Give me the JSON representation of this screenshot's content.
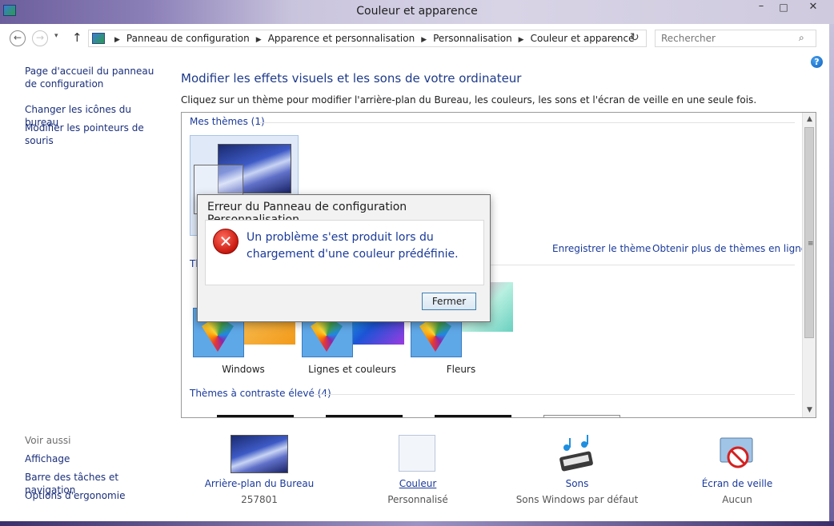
{
  "window": {
    "title": "Couleur et apparence",
    "controls": {
      "minimize": "–",
      "maximize": "□",
      "close": "✕"
    }
  },
  "nav": {
    "back": "←",
    "forward": "→",
    "recent": "▾",
    "up": "↑",
    "breadcrumbs": [
      "Panneau de configuration",
      "Apparence et personnalisation",
      "Personnalisation",
      "Couleur et apparence"
    ],
    "dropdown": "⌄",
    "refresh": "↻",
    "search_placeholder": "Rechercher",
    "search_icon": "⌕",
    "help": "?"
  },
  "sidebar": {
    "home_link": "Page d'accueil du panneau de configuration",
    "links": [
      "Changer les icônes du bureau",
      "Modifier les pointeurs de souris"
    ],
    "see_also_title": "Voir aussi",
    "see_also": [
      "Affichage",
      "Barre des tâches et navigation",
      "Options d'ergonomie"
    ]
  },
  "main": {
    "heading": "Modifier les effets visuels et les sons de votre ordinateur",
    "subtext": "Cliquez sur un thème pour modifier l'arrière-plan du Bureau, les couleurs, les sons et l'écran de veille en une seule fois.",
    "my_themes": "Mes thèmes (1)",
    "windows_themes_partial": "Th",
    "save_theme": "Enregistrer le thème",
    "more_themes": "Obtenir plus de thèmes en ligne",
    "themes": [
      "Windows",
      "Lignes et couleurs",
      "Fleurs"
    ],
    "high_contrast": "Thèmes à contraste élevé (4)",
    "scroll": {
      "up": "▲",
      "down": "▼",
      "grip": "≡"
    }
  },
  "bottom": [
    {
      "label": "Arrière-plan du Bureau",
      "sub": "257801"
    },
    {
      "label": "Couleur",
      "sub": "Personnalisé"
    },
    {
      "label": "Sons",
      "sub": "Sons Windows par défaut"
    },
    {
      "label": "Écran de veille",
      "sub": "Aucun"
    }
  ],
  "dialog": {
    "title": "Erreur du Panneau de configuration Personnalisation",
    "error_glyph": "✕",
    "message": "Un problème s'est produit lors du chargement d'une couleur prédéfinie.",
    "button": "Fermer"
  },
  "colors": {
    "link": "#1a3a9a",
    "heading": "#1e3a8a",
    "titlebar": "#8c80b8",
    "error": "#c8180e"
  }
}
